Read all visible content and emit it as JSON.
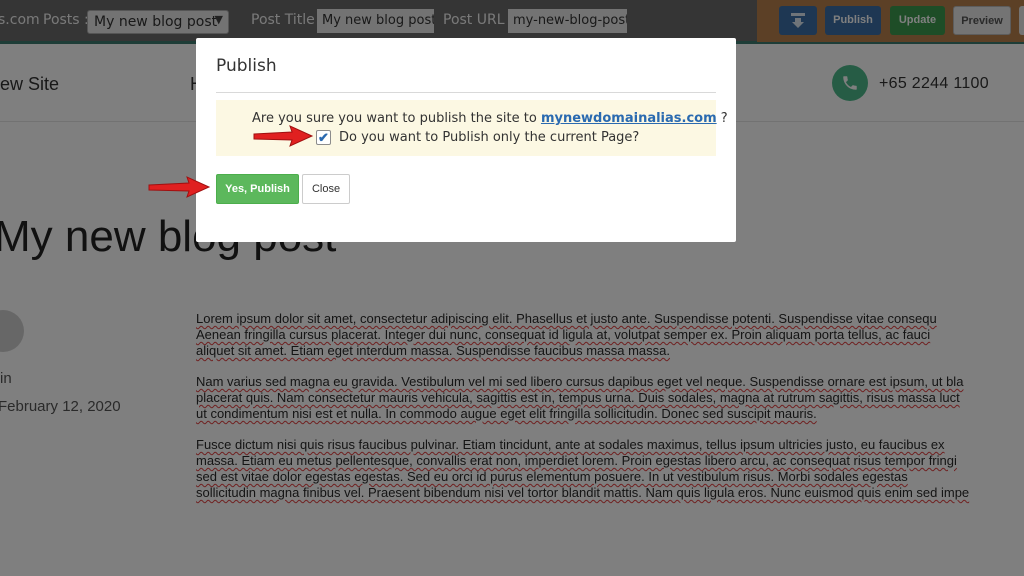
{
  "toolbar": {
    "domain_fragment": "s.com",
    "posts_label": "Posts :",
    "posts_selected": "My new blog post",
    "post_title_label": "Post Title :",
    "post_title_value": "My new blog post",
    "post_url_label": "Post URL :",
    "post_url_value": "my-new-blog-post",
    "publish_label": "Publish",
    "update_label": "Update",
    "preview_label": "Preview"
  },
  "site": {
    "name_fragment": "ew Site",
    "nav_fragment": "H",
    "phone": "+65 2244 1100"
  },
  "post": {
    "title": "My new blog post",
    "author_fragment": "in",
    "date": "February 12, 2020",
    "paragraphs": [
      "Lorem ipsum dolor sit amet, consectetur adipiscing elit. Phasellus et justo ante. Suspendisse potenti. Suspendisse vitae consequ\nAenean fringilla cursus placerat. Integer dui nunc, consequat id ligula at, volutpat semper ex. Proin aliquam porta tellus, ac fauci\naliquet sit amet. Etiam eget interdum massa. Suspendisse faucibus massa massa.",
      "Nam varius sed magna eu gravida. Vestibulum vel mi sed libero cursus dapibus eget vel neque. Suspendisse ornare est ipsum, ut bla\nplacerat quis. Nam consectetur mauris vehicula, sagittis est in, tempus urna. Duis sodales, magna at rutrum sagittis, risus massa luct\nut condimentum nisi est et nulla. In commodo augue eget elit fringilla sollicitudin. Donec sed suscipit mauris.",
      "Fusce dictum nisi quis risus faucibus pulvinar. Etiam tincidunt, ante at sodales maximus, tellus ipsum ultricies justo, eu faucibus ex\nmassa. Etiam eu metus pellentesque, convallis erat non, imperdiet lorem. Proin egestas libero arcu, ac consequat risus tempor fringi\nsed est vitae dolor egestas egestas. Sed eu orci id purus elementum posuere. In ut vestibulum risus. Morbi sodales egestas\nsollicitudin magna finibus vel. Praesent bibendum nisi vel tortor blandit mattis. Nam quis ligula eros. Nunc euismod quis enim sed impe"
    ]
  },
  "modal": {
    "title": "Publish",
    "question_prefix": "Are you sure you want to publish the site to ",
    "domain": "mynewdomainalias.com",
    "question_suffix": " ?",
    "checkbox_checked": true,
    "checkbox_label": "Do you want to Publish only the current Page?",
    "yes_button": "Yes, Publish",
    "close_button": "Close"
  },
  "icons": {
    "download": "download-icon",
    "phone": "phone-icon",
    "checkmark": "checkmark-icon",
    "arrow": "red-arrow-icon"
  },
  "colors": {
    "yes_button": "#5cb85c",
    "publish_button": "#3d6fa6",
    "update_button": "#3d9a4f",
    "arrow": "#e02020",
    "link": "#2a6ab0",
    "alert_bg": "#fcf8e3"
  }
}
